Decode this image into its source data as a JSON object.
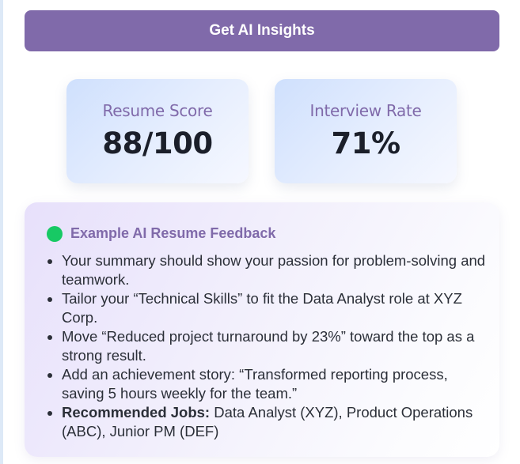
{
  "insights_button": {
    "label": "Get AI Insights"
  },
  "stats": {
    "resume_score": {
      "label": "Resume Score",
      "value": "88/100"
    },
    "interview_rate": {
      "label": "Interview Rate",
      "value": "71%"
    }
  },
  "feedback": {
    "title": "Example AI Resume Feedback",
    "items": [
      "Your summary should show your passion for problem-solving and teamwork.",
      "Tailor your “Technical Skills” to fit the Data Analyst role at XYZ Corp.",
      "Move “Reduced project turnaround by 23%” toward the top as a strong result.",
      "Add an achievement story: “Transformed reporting process, saving 5 hours weekly for the team.”"
    ],
    "recommended": {
      "label": "Recommended Jobs:",
      "text": " Data Analyst (XYZ), Product Operations (ABC), Junior PM (DEF)"
    }
  },
  "colors": {
    "accent": "#806aaa",
    "status_dot": "#17c964",
    "text": "#2b2f38"
  }
}
